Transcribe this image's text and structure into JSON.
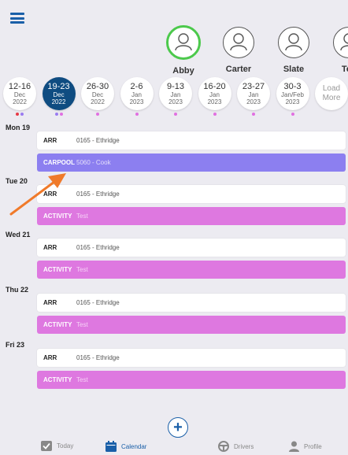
{
  "drivers": [
    {
      "name": "Abby",
      "selected": true
    },
    {
      "name": "Carter",
      "selected": false
    },
    {
      "name": "Slate",
      "selected": false
    },
    {
      "name": "Tes",
      "selected": false
    }
  ],
  "weeks": [
    {
      "range": "12-16",
      "month": "Dec",
      "year": "2022",
      "dots": [
        "#e63946",
        "#9a7bf0"
      ]
    },
    {
      "range": "19-23",
      "month": "Dec",
      "year": "2022",
      "dots": [
        "#9a7bf0",
        "#e070e0"
      ],
      "selected": true
    },
    {
      "range": "26-30",
      "month": "Dec",
      "year": "2022",
      "dots": [
        "#e070e0"
      ]
    },
    {
      "range": "2-6",
      "month": "Jan",
      "year": "2023",
      "dots": [
        "#e070e0"
      ]
    },
    {
      "range": "9-13",
      "month": "Jan",
      "year": "2023",
      "dots": [
        "#e070e0"
      ]
    },
    {
      "range": "16-20",
      "month": "Jan",
      "year": "2023",
      "dots": [
        "#e070e0"
      ]
    },
    {
      "range": "23-27",
      "month": "Jan",
      "year": "2023",
      "dots": [
        "#e070e0"
      ]
    },
    {
      "range": "30-3",
      "month": "Jan/Feb",
      "year": "2023",
      "dots": [
        "#e070e0"
      ]
    },
    {
      "range": "Load",
      "month": "More",
      "year": "",
      "load": true,
      "dots": []
    }
  ],
  "days": [
    {
      "label": "Mon 19",
      "rows": [
        {
          "tag": "ARR",
          "desc": "0165 - Ethridge",
          "style": "white"
        },
        {
          "tag": "CARPOOL",
          "desc": "5060 - Cook",
          "style": "purple"
        }
      ]
    },
    {
      "label": "Tue 20",
      "rows": [
        {
          "tag": "ARR",
          "desc": "0165 - Ethridge",
          "style": "white"
        },
        {
          "tag": "ACTIVITY",
          "desc": "Test",
          "style": "pink"
        }
      ]
    },
    {
      "label": "Wed 21",
      "rows": [
        {
          "tag": "ARR",
          "desc": "0165 - Ethridge",
          "style": "white"
        },
        {
          "tag": "ACTIVITY",
          "desc": "Test",
          "style": "pink"
        }
      ]
    },
    {
      "label": "Thu 22",
      "rows": [
        {
          "tag": "ARR",
          "desc": "0165 - Ethridge",
          "style": "white"
        },
        {
          "tag": "ACTIVITY",
          "desc": "Test",
          "style": "pink"
        }
      ]
    },
    {
      "label": "Fri 23",
      "rows": [
        {
          "tag": "ARR",
          "desc": "0165 - Ethridge",
          "style": "white"
        },
        {
          "tag": "ACTIVITY",
          "desc": "Test",
          "style": "pink"
        }
      ]
    }
  ],
  "tabs": {
    "today": "Today",
    "calendar": "Calendar",
    "drivers": "Drivers",
    "profile": "Profile",
    "add": "+"
  },
  "colors": {
    "accent": "#1a5fa8",
    "selected_week": "#0f4c81",
    "carpool": "#8c7ff0",
    "activity": "#de78e0",
    "annotation_arrow": "#f07a2a"
  },
  "icons": {
    "menu": "hamburger-menu-icon",
    "today": "checkbox-icon",
    "calendar": "calendar-icon",
    "drivers": "steering-wheel-icon",
    "profile": "person-icon",
    "add": "plus-icon"
  }
}
